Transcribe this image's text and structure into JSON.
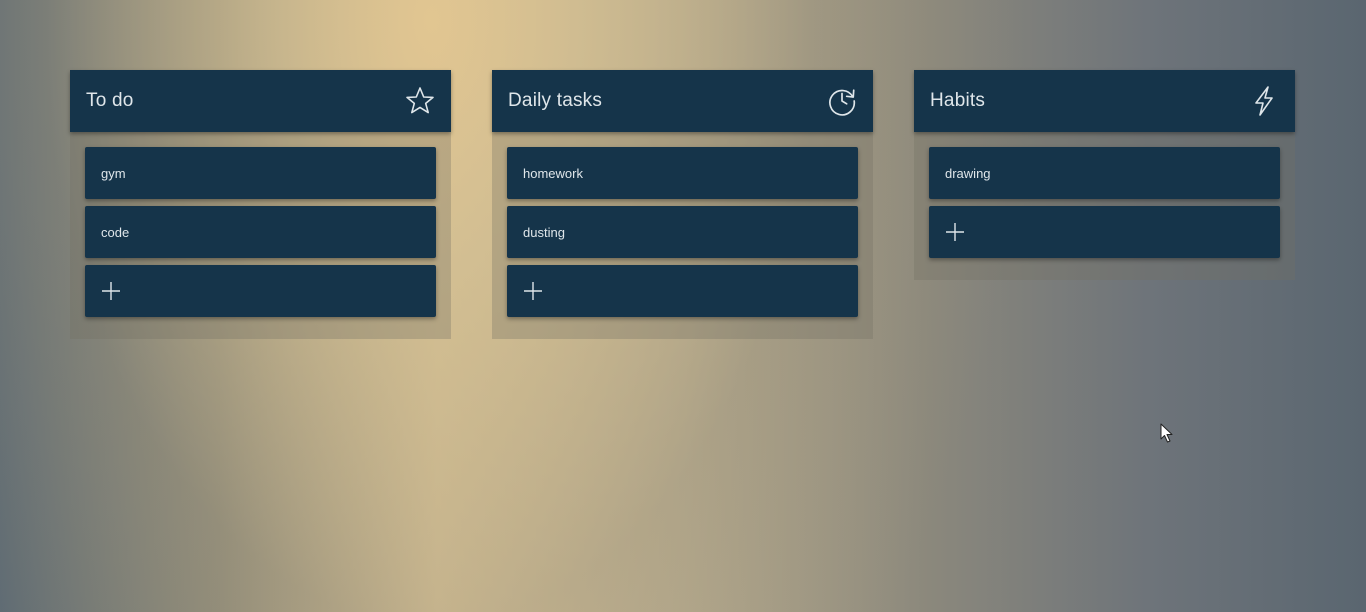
{
  "columns": [
    {
      "title": "To do",
      "icon": "star-icon",
      "cards": [
        "gym",
        "code"
      ]
    },
    {
      "title": "Daily tasks",
      "icon": "clock-refresh-icon",
      "cards": [
        "homework",
        "dusting"
      ]
    },
    {
      "title": "Habits",
      "icon": "lightning-icon",
      "cards": [
        "drawing"
      ]
    }
  ],
  "colors": {
    "card_bg": "#15344a",
    "text": "#dfe6ea"
  }
}
